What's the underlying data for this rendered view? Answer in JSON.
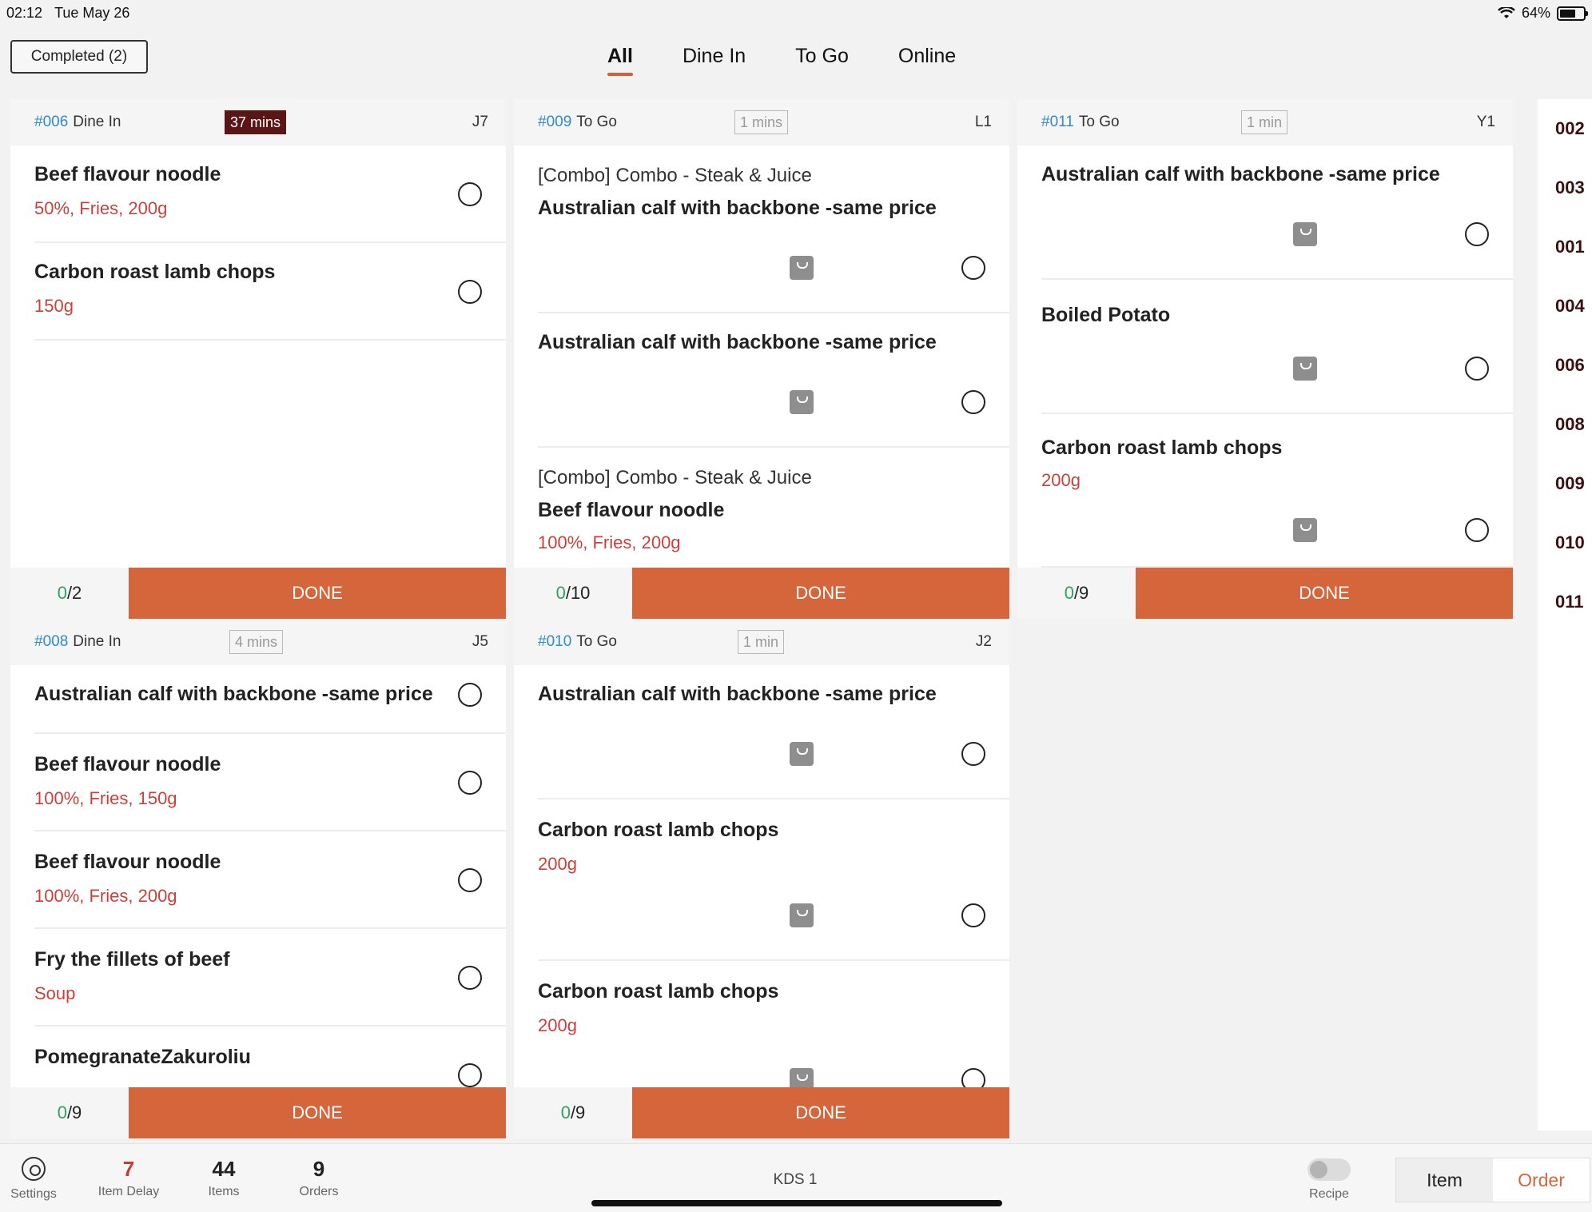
{
  "status_bar": {
    "time": "02:12",
    "date": "Tue May 26",
    "battery": "64%",
    "battery_level": 0.64,
    "icons": [
      "wifi-icon",
      "battery-icon"
    ]
  },
  "header": {
    "completed_label": "Completed (2)",
    "tabs": [
      {
        "label": "All",
        "active": true
      },
      {
        "label": "Dine In",
        "active": false
      },
      {
        "label": "To Go",
        "active": false
      },
      {
        "label": "Online",
        "active": false
      }
    ]
  },
  "orders": [
    {
      "id": "#006",
      "type": "Dine In",
      "timer": "37 mins",
      "late": true,
      "table": "J7",
      "count_done": "0",
      "count_total": "/2",
      "done_label": "DONE",
      "items": [
        {
          "name": "Beef flavour noodle",
          "mods": "50%, Fries, 200g"
        },
        {
          "name": "Carbon roast lamb chops",
          "mods": "150g"
        }
      ]
    },
    {
      "id": "#009",
      "type": "To Go",
      "timer": "1 mins",
      "late": false,
      "table": "L1",
      "count_done": "0",
      "count_total": "/10",
      "done_label": "DONE",
      "items": [
        {
          "combo": "[Combo] Combo - Steak & Juice",
          "name": "Australian calf with backbone -same price"
        },
        {
          "name": "Australian calf with backbone -same price"
        },
        {
          "combo": "[Combo] Combo - Steak & Juice",
          "name": "Beef flavour noodle",
          "mods": "100%, Fries, 200g"
        }
      ]
    },
    {
      "id": "#011",
      "type": "To Go",
      "timer": "1 min",
      "late": false,
      "table": "Y1",
      "count_done": "0",
      "count_total": "/9",
      "done_label": "DONE",
      "items": [
        {
          "name": "Australian calf with backbone -same price"
        },
        {
          "name": "Boiled Potato"
        },
        {
          "name": "Carbon roast lamb chops",
          "mods": "200g"
        }
      ]
    },
    {
      "id": "#008",
      "type": "Dine In",
      "timer": "4 mins",
      "late": false,
      "table": "J5",
      "count_done": "0",
      "count_total": "/9",
      "done_label": "DONE",
      "items": [
        {
          "name": "Australian calf with backbone -same price"
        },
        {
          "name": "Beef flavour noodle",
          "mods": "100%, Fries, 150g"
        },
        {
          "name": "Beef flavour noodle",
          "mods": "100%, Fries, 200g"
        },
        {
          "name": "Fry the fillets of beef",
          "mods": "Soup"
        },
        {
          "name": "PomegranateZakuroliu"
        }
      ]
    },
    {
      "id": "#010",
      "type": "To Go",
      "timer": "1 min",
      "late": false,
      "table": "J2",
      "count_done": "0",
      "count_total": "/9",
      "done_label": "DONE",
      "items": [
        {
          "name": "Australian calf with backbone -same price"
        },
        {
          "name": "Carbon roast lamb chops",
          "mods": "200g"
        },
        {
          "name": "Carbon roast lamb chops",
          "mods": "200g"
        }
      ]
    }
  ],
  "side_list": [
    "002",
    "003",
    "001",
    "004",
    "006",
    "008",
    "009",
    "010",
    "011"
  ],
  "bottom_bar": {
    "settings_label": "Settings",
    "item_delay_value": "7",
    "item_delay_label": "Item Delay",
    "items_value": "44",
    "items_label": "Items",
    "orders_value": "9",
    "orders_label": "Orders",
    "station": "KDS 1",
    "recipe_label": "Recipe",
    "view_item": "Item",
    "view_order": "Order"
  },
  "colors": {
    "accent": "#d5653a",
    "order_number": "#2f8bc9",
    "modifier": "#c9413a",
    "late_timer": "#5a1515",
    "done_count": "#2ca35e"
  }
}
